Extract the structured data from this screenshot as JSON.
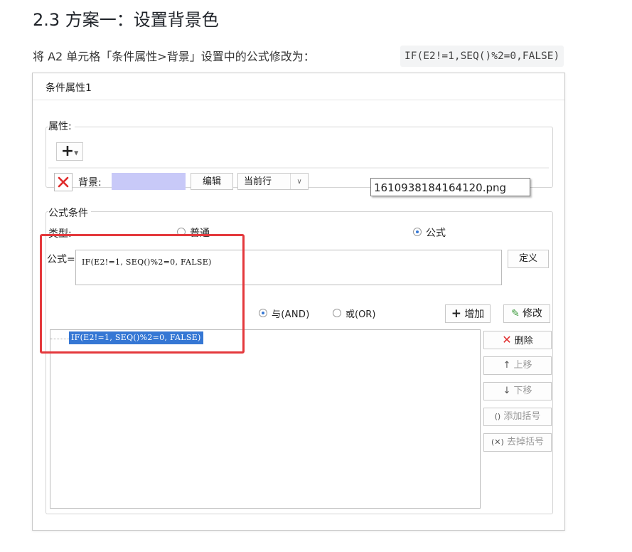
{
  "heading": "2.3 方案一：设置背景色",
  "intro": {
    "text": "将 A2 单元格「条件属性>背景」设置中的公式修改为：",
    "code": "IF(E2!=1,SEQ()%2=0,FALSE)"
  },
  "dialog": {
    "title": "条件属性1",
    "attr_group": {
      "label": "属性:",
      "add_label": "+",
      "row": {
        "label": "背景:",
        "swatch_color": "#c8c9f8",
        "edit_button": "编辑",
        "scope_value": "当前行"
      }
    },
    "tooltip": "1610938184164120.png",
    "formula_group": {
      "label": "公式条件",
      "type_label": "类型:",
      "type_options": [
        "普通",
        "公式"
      ],
      "selected_type": "公式",
      "formula_label": "公式=",
      "formula_value": "IF(E2!=1, SEQ()%2=0, FALSE)",
      "define_button": "定义",
      "logic_options": [
        "与(AND)",
        "或(OR)"
      ],
      "selected_logic": "与(AND)",
      "add_button": "增加",
      "modify_button": "修改",
      "conditions": [
        "IF(E2!=1, SEQ()%2=0, FALSE)"
      ],
      "side_buttons": {
        "delete": "删除",
        "move_up": "上移",
        "move_down": "下移",
        "add_bracket": "添加括号",
        "remove_bracket": "去掉括号"
      }
    }
  },
  "colors": {
    "highlight": "#e4383c",
    "selection": "#3577d4",
    "swatch": "#c8c9f8"
  }
}
